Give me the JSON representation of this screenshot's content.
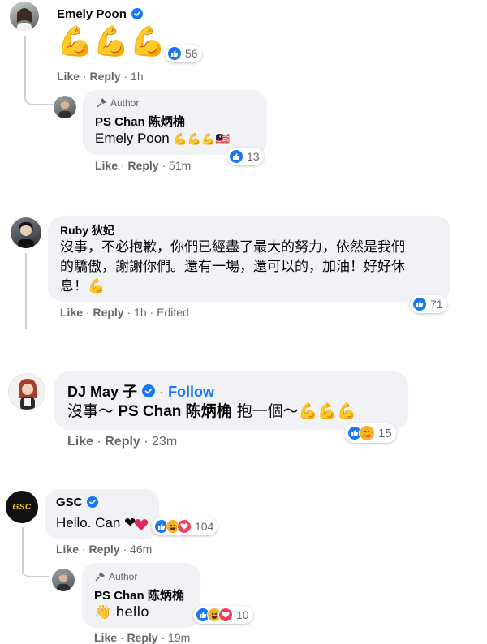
{
  "comments": [
    {
      "author": "Emely Poon",
      "verified": true,
      "text": "💪💪💪",
      "reaction_count": "56",
      "actions": {
        "like": "Like",
        "reply": "Reply",
        "sep": " · ",
        "time": "1h"
      },
      "reply": {
        "badge": "Author",
        "author": "PS Chan 陈炳桷",
        "mention": "Emely Poon",
        "text_emojis": "💪💪💪🇲🇾",
        "reaction_count": "13",
        "actions": {
          "like": "Like",
          "reply": "Reply",
          "time": "51m"
        }
      }
    },
    {
      "author": "Ruby 狄妃",
      "text": "沒事，不必抱歉，你們已經盡了最大的努力，依然是我們的驕傲，謝謝你們。還有一場，還可以的，加油！好好休息！💪",
      "text_lines": [
        "沒事，不必抱歉，你們已經盡了最大的努力，依然是我們",
        "的驕傲，謝謝你們。還有一場，還可以的，加油！好好休",
        "息！💪"
      ],
      "reaction_count": "71",
      "actions": {
        "like": "Like",
        "reply": "Reply",
        "time": "1h",
        "edited": "Edited"
      }
    },
    {
      "author": "DJ May 子",
      "verified": true,
      "follow": "Follow",
      "text": "沒事～ PS Chan 陈炳桷 抱一個～💪💪💪",
      "text_pre": "沒事～ ",
      "mention": "PS Chan 陈炳桷",
      "text_post": " 抱一個～💪💪💪",
      "reaction_count": "15",
      "actions": {
        "like": "Like",
        "reply": "Reply",
        "time": "23m"
      }
    },
    {
      "author": "GSC",
      "avatar_text": "GSC",
      "verified": true,
      "text": "Hello. Can ❤",
      "reaction_count": "104",
      "actions": {
        "like": "Like",
        "reply": "Reply",
        "time": "46m"
      },
      "reply": {
        "badge": "Author",
        "author": "PS Chan 陈炳桷",
        "text": "👋 hello",
        "reaction_count": "10",
        "actions": {
          "like": "Like",
          "reply": "Reply",
          "time": "19m"
        }
      }
    }
  ],
  "colors": {
    "bubble": "#f0f2f5",
    "link": "#1877f2",
    "meta": "#65676b",
    "like": "#1877f2",
    "love": "#f33e58",
    "haha": "#f7b125"
  },
  "icons": [
    "verified-badge-icon",
    "like-reaction-icon",
    "haha-reaction-icon",
    "love-reaction-icon",
    "care-reaction-icon",
    "author-mic-icon",
    "heart-emoji-icon",
    "flexed-biceps-emoji-icon"
  ]
}
